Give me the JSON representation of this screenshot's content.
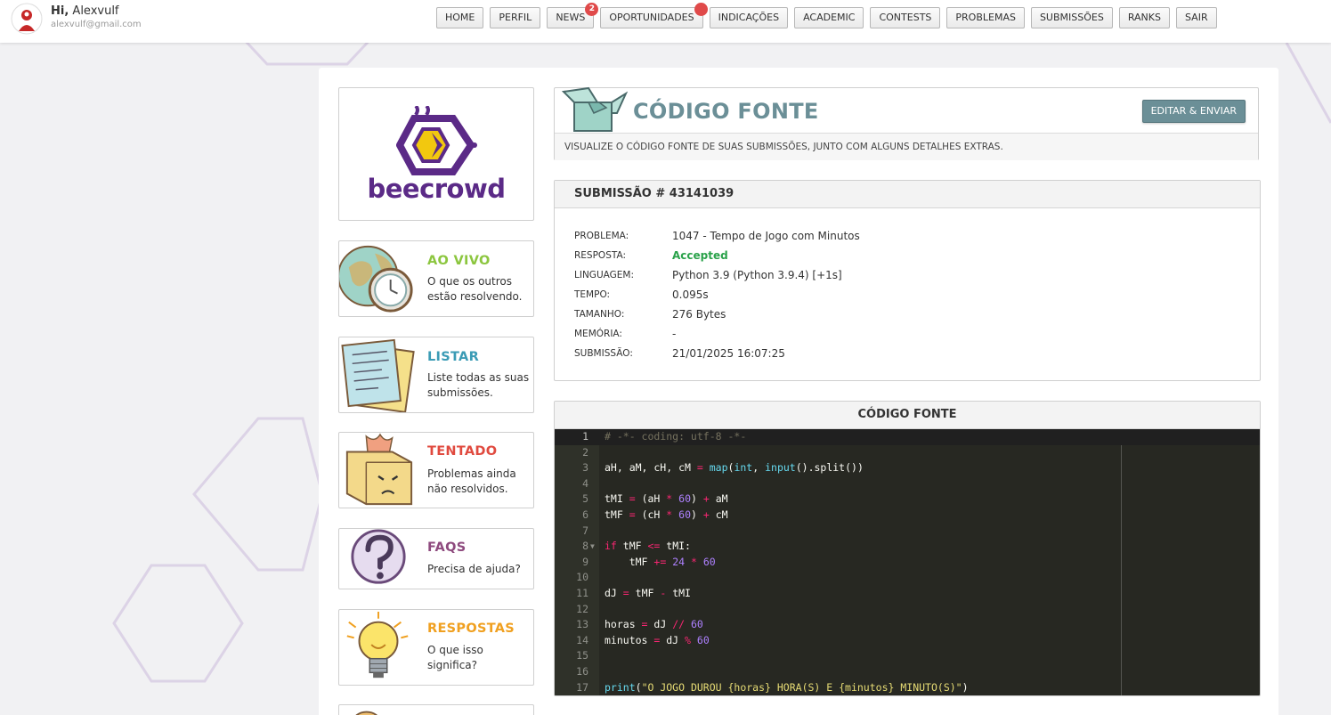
{
  "user": {
    "greeting": "Hi,",
    "name": "Alexvulf",
    "email": "alexvulf@gmail.com"
  },
  "nav": [
    {
      "label": "HOME"
    },
    {
      "label": "PERFIL"
    },
    {
      "label": "NEWS",
      "badge": "2"
    },
    {
      "label": "OPORTUNIDADES",
      "dot": true
    },
    {
      "label": "INDICAÇÕES"
    },
    {
      "label": "ACADEMIC"
    },
    {
      "label": "CONTESTS"
    },
    {
      "label": "PROBLEMAS"
    },
    {
      "label": "SUBMISSÕES"
    },
    {
      "label": "RANKS"
    },
    {
      "label": "SAIR"
    }
  ],
  "logo": {
    "text": "beecrowd"
  },
  "sidebar": [
    {
      "title": "AO VIVO",
      "desc": "O que os outros estão resolvendo.",
      "color": "#8cc63f",
      "icon": "globe-clock-icon"
    },
    {
      "title": "LISTAR",
      "desc": "Liste todas as suas submissões.",
      "color": "#3a9bb5",
      "icon": "papers-icon"
    },
    {
      "title": "TENTADO",
      "desc": "Problemas ainda não resolvidos.",
      "color": "#e04a3f",
      "icon": "sad-box-icon"
    },
    {
      "title": "FAQS",
      "desc": "Precisa de ajuda?",
      "color": "#8e4a7e",
      "icon": "question-icon"
    },
    {
      "title": "RESPOSTAS",
      "desc": "O que isso significa?",
      "color": "#f0a020",
      "icon": "lightbulb-icon"
    }
  ],
  "page": {
    "title": "CÓDIGO FONTE",
    "button": "EDITAR & ENVIAR",
    "subtitle": "VISUALIZE O CÓDIGO FONTE DE SUAS SUBMISSÕES, JUNTO COM ALGUNS DETALHES EXTRAS."
  },
  "submission": {
    "header": "SUBMISSÃO # 43141039",
    "rows": [
      {
        "label": "PROBLEMA:",
        "value": "1047 - Tempo de Jogo com Minutos"
      },
      {
        "label": "RESPOSTA:",
        "value": "Accepted"
      },
      {
        "label": "LINGUAGEM:",
        "value": "Python 3.9 (Python 3.9.4) [+1s]"
      },
      {
        "label": "TEMPO:",
        "value": "0.095s"
      },
      {
        "label": "TAMANHO:",
        "value": "276 Bytes"
      },
      {
        "label": "MEMÓRIA:",
        "value": "-"
      },
      {
        "label": "SUBMISSÃO:",
        "value": "21/01/2025 16:07:25"
      }
    ]
  },
  "code": {
    "header": "CÓDIGO FONTE",
    "lines": [
      "# -*- coding: utf-8 -*-",
      "",
      "aH, aM, cH, cM = map(int, input().split())",
      "",
      "tMI = (aH * 60) + aM",
      "tMF = (cH * 60) + cM",
      "",
      "if tMF <= tMI:",
      "    tMF += 24 * 60",
      "",
      "dJ = tMF - tMI",
      "",
      "horas = dJ // 60",
      "minutos = dJ % 60",
      "",
      "",
      "print(f\"O JOGO DUROU {horas} HORA(S) E {minutos} MINUTO(S)\")"
    ]
  },
  "colors": {
    "accent": "#6b8f97",
    "accepted": "#2aa24a",
    "brand": "#5b2a87",
    "badge": "#e04a4a",
    "editor_bg": "#272822"
  }
}
